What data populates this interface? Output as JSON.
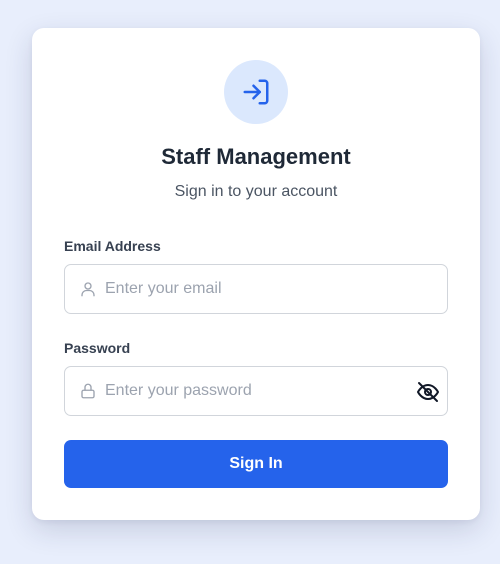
{
  "header": {
    "logo_icon": "sign-in-icon",
    "title": "Staff Management",
    "subtitle": "Sign in to your account"
  },
  "form": {
    "email": {
      "label": "Email Address",
      "placeholder": "Enter your email",
      "value": "",
      "icon": "user-icon"
    },
    "password": {
      "label": "Password",
      "placeholder": "Enter your password",
      "value": "",
      "icon": "lock-icon",
      "toggle_icon": "eye-off-icon"
    },
    "submit_label": "Sign In"
  },
  "colors": {
    "accent": "#2563eb",
    "logo_bg": "#dbe8fd",
    "page_bg": "#e8eefc"
  }
}
